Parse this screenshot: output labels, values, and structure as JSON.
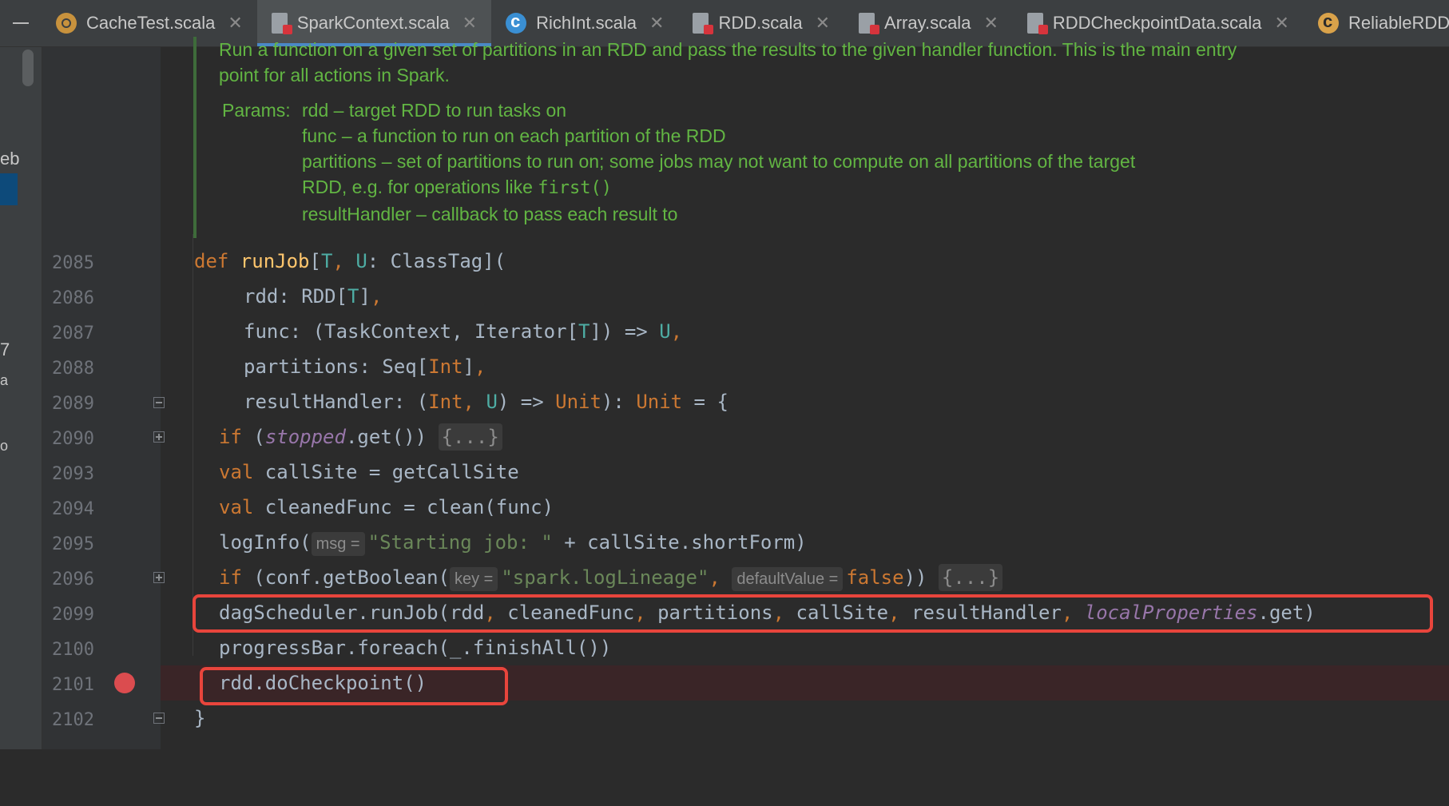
{
  "tabs": [
    {
      "label": "CacheTest.scala",
      "icon": "scala-object-icon",
      "active": false
    },
    {
      "label": "SparkContext.scala",
      "icon": "scala-file-icon",
      "active": true
    },
    {
      "label": "RichInt.scala",
      "icon": "scala-class-icon",
      "active": false
    },
    {
      "label": "RDD.scala",
      "icon": "scala-file-icon",
      "active": false
    },
    {
      "label": "Array.scala",
      "icon": "scala-file-icon",
      "active": false
    },
    {
      "label": "RDDCheckpointData.scala",
      "icon": "scala-file-icon",
      "active": false
    },
    {
      "label": "ReliableRDDCheckpo",
      "icon": "scala-class-icon",
      "active": false
    }
  ],
  "left_panel": {
    "fragments": [
      "eb",
      "7",
      "a",
      "o"
    ]
  },
  "doc_comment": {
    "summary": "Run a function on a given set of partitions in an RDD and pass the results to the given handler function. This is the main entry point for all actions in Spark.",
    "params_label": "Params:",
    "params": [
      "rdd – target RDD to run tasks on",
      "func – a function to run on each partition of the RDD",
      "partitions – set of partitions to run on; some jobs may not want to compute on all partitions of the target",
      "RDD, e.g. for operations like",
      "resultHandler – callback to pass each result to"
    ],
    "code_ref": "first()"
  },
  "code_lines": [
    {
      "num": "2085",
      "tokens": {
        "k": "def ",
        "f": "runJob",
        "a": "[",
        "t1": "T",
        "b": ", ",
        "t2": "U",
        "c": ": ClassTag]("
      }
    },
    {
      "num": "2086",
      "text_a": "rdd: RDD[",
      "t": "T",
      "text_b": "]",
      "comma": ","
    },
    {
      "num": "2087",
      "text_a": "func: (TaskContext, Iterator[",
      "t": "T",
      "text_b": "]) => ",
      "u": "U",
      "comma": ","
    },
    {
      "num": "2088",
      "text_a": "partitions: Seq[",
      "int": "Int",
      "text_b": "]",
      "comma": ","
    },
    {
      "num": "2089",
      "text_a": "resultHandler: (",
      "int": "Int",
      "c1": ", ",
      "u": "U",
      "text_b": ") => ",
      "unit1": "Unit",
      "text_c": "): ",
      "unit2": "Unit",
      "text_d": " = {"
    },
    {
      "num": "2090",
      "kw": "if ",
      "text_a": "(",
      "fld": "stopped",
      "text_b": ".get()) ",
      "folded": "{...}"
    },
    {
      "num": "2093",
      "kw": "val ",
      "text_a": "callSite = getCallSite"
    },
    {
      "num": "2094",
      "kw": "val ",
      "text_a": "cleanedFunc = clean(func)"
    },
    {
      "num": "2095",
      "text_a": "logInfo(",
      "hint": "msg =",
      "str": "\"Starting job: \"",
      "text_b": " + callSite.shortForm)"
    },
    {
      "num": "2096",
      "kw": "if ",
      "text_a": "(conf.getBoolean(",
      "hint1": "key =",
      "str": "\"spark.logLineage\"",
      "comma": ", ",
      "hint2": "defaultValue =",
      "kw2": "false",
      "text_b": ")) ",
      "folded": "{...}"
    },
    {
      "num": "2099",
      "text_a": "dagScheduler.runJob(rdd",
      "c1": ", ",
      "text_b": "cleanedFunc",
      "c2": ", ",
      "text_c": "partitions",
      "c3": ", ",
      "text_d": "callSite",
      "c4": ", ",
      "text_e": "resultHandler",
      "c5": ", ",
      "fld": "localProperties",
      "text_f": ".get)"
    },
    {
      "num": "2100",
      "text_a": "progressBar.foreach(_.finishAll())"
    },
    {
      "num": "2101",
      "text_a": "rdd.doCheckpoint()"
    },
    {
      "num": "2102",
      "text_a": "}"
    }
  ],
  "colors": {
    "accent_tab": "#4a88c7",
    "annotation_red": "#e8453c",
    "breakpoint": "#db4c4f",
    "doc_green": "#62b543",
    "keyword": "#cc7832",
    "function": "#ffc66d",
    "type_param": "#4eada4",
    "string": "#6a8759",
    "field": "#9876aa"
  }
}
